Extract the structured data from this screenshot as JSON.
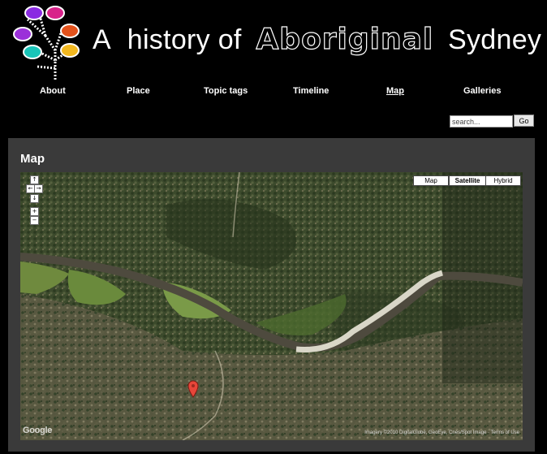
{
  "site": {
    "title_part1": "A",
    "title_part2": "history of",
    "title_part3": "Aboriginal",
    "title_part4": "Sydney",
    "logo_icon": "tree-logo-icon"
  },
  "nav": {
    "items": [
      {
        "label": "About",
        "active": false
      },
      {
        "label": "Place",
        "active": false
      },
      {
        "label": "Topic tags",
        "active": false
      },
      {
        "label": "Timeline",
        "active": false
      },
      {
        "label": "Map",
        "active": true
      },
      {
        "label": "Galleries",
        "active": false
      }
    ]
  },
  "search": {
    "value": "search...",
    "go_label": "Go"
  },
  "content": {
    "title": "Map"
  },
  "map": {
    "type_buttons": [
      {
        "label": "Map",
        "selected": false
      },
      {
        "label": "Satellite",
        "selected": true
      },
      {
        "label": "Hybrid",
        "selected": false
      }
    ],
    "pan_controls": [
      "↑",
      "←",
      "→",
      "↓"
    ],
    "zoom_controls": [
      "+",
      "−"
    ],
    "logo_text": "Google",
    "attribution": "Imagery ©2010 DigitalGlobe, GeoEye, Cnes/Spot Image · Terms of Use",
    "marker_icon": "map-pin-icon"
  },
  "colors": {
    "background": "#000000",
    "panel": "#3a3a3a",
    "marker": "#e8463a"
  }
}
